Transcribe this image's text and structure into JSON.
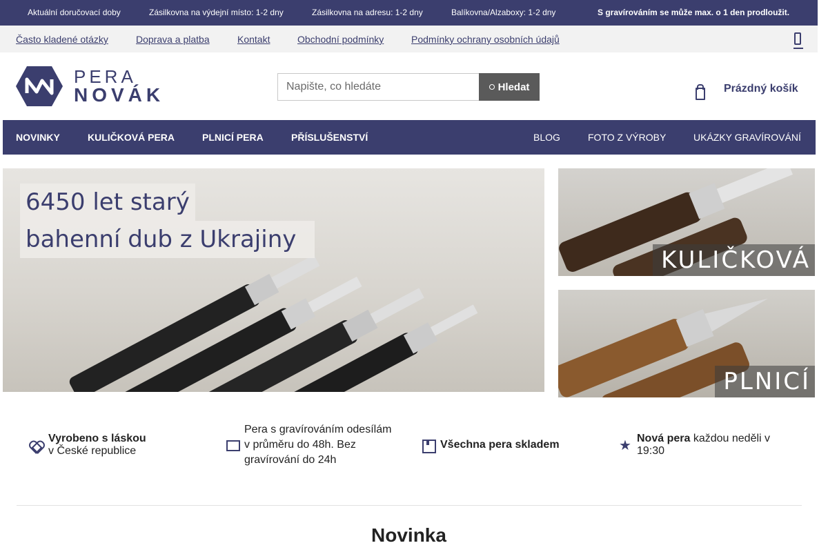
{
  "infobar": {
    "items": [
      "Aktuální doručovací doby",
      "Zásilkovna na výdejní místo: 1-2 dny",
      "Zásilkovna na adresu: 1-2 dny",
      "Balíkovna/Alzaboxy: 1-2 dny"
    ],
    "warning": "S gravírováním se může max. o 1 den prodloužit."
  },
  "linkbar": {
    "links": [
      "Často kladené otázky",
      "Doprava a platba",
      "Kontakt",
      "Obchodní podmínky",
      "Podmínky ochrany osobních údajů"
    ]
  },
  "logo": {
    "line1": "PERA",
    "line2": "NOVÁK"
  },
  "search": {
    "placeholder": "Napište, co hledáte",
    "button": "Hledat"
  },
  "cart": {
    "label": "Prázdný košík"
  },
  "nav": {
    "left": [
      "NOVINKY",
      "KULIČKOVÁ PERA",
      "PLNICÍ PERA",
      "PŘÍSLUŠENSTVÍ"
    ],
    "right": [
      "BLOG",
      "FOTO Z VÝROBY",
      "UKÁZKY GRAVÍROVÁNÍ"
    ]
  },
  "banners": {
    "main": {
      "line1": "6450 let starý",
      "line2": "bahenní dub z Ukrajiny"
    },
    "ballpoint": {
      "label": "KULIČKOVÁ"
    },
    "fountain": {
      "label": "PLNICÍ"
    }
  },
  "features": [
    {
      "icon": "heart-icon",
      "bold": "Vyrobeno s láskou",
      "text": "v České republice"
    },
    {
      "icon": "truck-icon",
      "bold": "",
      "text": "Pera s gravírováním odesílám v průměru do 48h. Bez gravírování do 24h"
    },
    {
      "icon": "box-icon",
      "bold": "Všechna pera skladem",
      "text": ""
    },
    {
      "icon": "star-icon",
      "bold": "Nová pera",
      "text": "každou neděli v 19:30"
    }
  ],
  "section": {
    "title": "Novinka"
  },
  "colors": {
    "brand": "#3b3e6e",
    "search_button": "#5a5a5a",
    "linkbar_bg": "#f2f2f2"
  }
}
